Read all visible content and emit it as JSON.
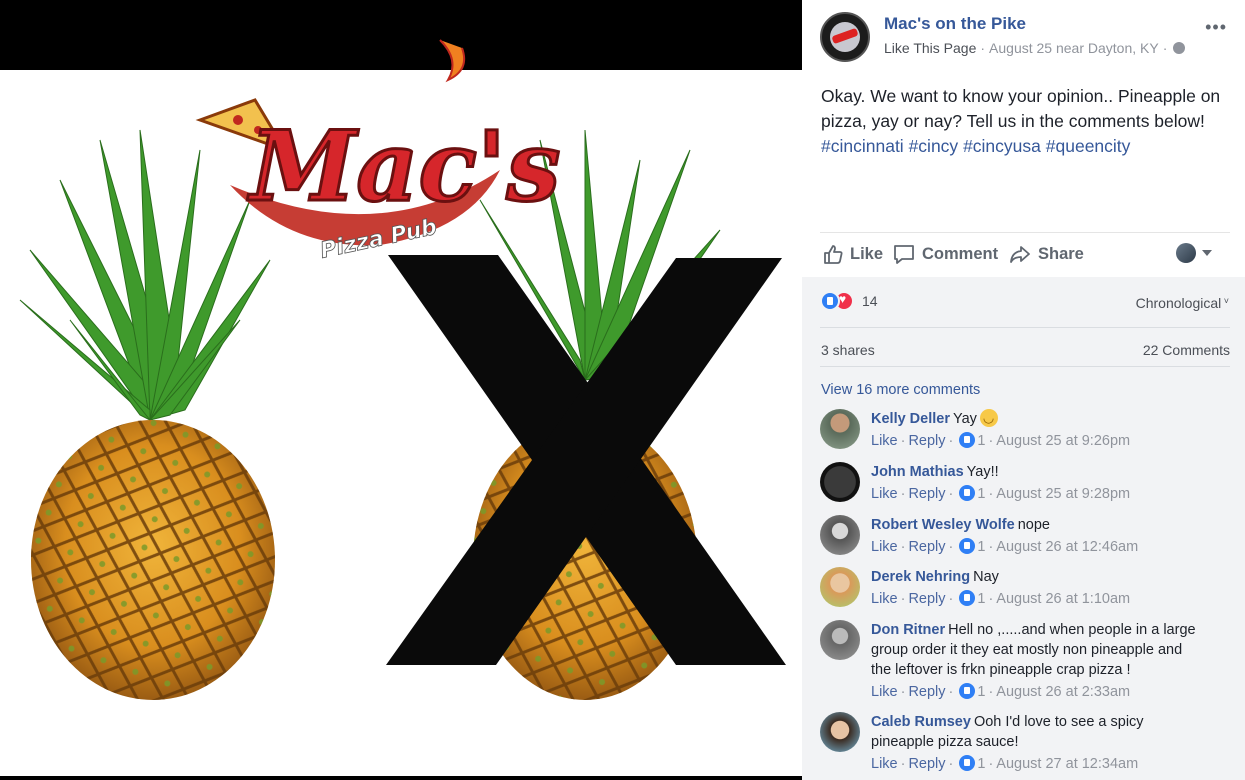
{
  "photo": {
    "logo_main": "Mac's",
    "logo_sub": "Pizza Pub"
  },
  "post": {
    "page_name": "Mac's on the Pike",
    "like_page": "Like This Page",
    "date_location": "August 25 near Dayton, KY",
    "text": "Okay. We want to know your opinion.. Pineapple on pizza, yay or nay? Tell us in the comments below!",
    "hashtags": [
      "#cincinnati",
      "#cincy",
      "#cincyusa",
      "#queencity"
    ]
  },
  "actions": {
    "like": "Like",
    "comment": "Comment",
    "share": "Share"
  },
  "reactions": {
    "count": "14",
    "order": "Chronological"
  },
  "stats": {
    "shares": "3 shares",
    "comments": "22 Comments"
  },
  "view_more": "View 16 more comments",
  "comments": [
    {
      "author": "Kelly Deller",
      "text": "Yay",
      "like": "Like",
      "reply": "Reply",
      "likes": "1",
      "time": "August 25 at 9:26pm"
    },
    {
      "author": "John Mathias",
      "text": "Yay!!",
      "like": "Like",
      "reply": "Reply",
      "likes": "1",
      "time": "August 25 at 9:28pm"
    },
    {
      "author": "Robert Wesley Wolfe",
      "text": "nope",
      "like": "Like",
      "reply": "Reply",
      "likes": "1",
      "time": "August 26 at 12:46am"
    },
    {
      "author": "Derek Nehring",
      "text": "Nay",
      "like": "Like",
      "reply": "Reply",
      "likes": "1",
      "time": "August 26 at 1:10am"
    },
    {
      "author": "Don Ritner",
      "text": "Hell no ,.....and when people in a large group order it they eat mostly non pineapple and the leftover is frkn pineapple crap pizza !",
      "like": "Like",
      "reply": "Reply",
      "likes": "1",
      "time": "August 26 at 2:33am"
    },
    {
      "author": "Caleb Rumsey",
      "text": "Ooh I'd love to see a spicy pineapple pizza sauce!",
      "like": "Like",
      "reply": "Reply",
      "likes": "1",
      "time": "August 27 at 12:34am"
    }
  ],
  "colors": {
    "link": "#365899",
    "muted": "#90949c",
    "panel_bg": "#f2f3f5",
    "logo_red": "#d6262b"
  }
}
